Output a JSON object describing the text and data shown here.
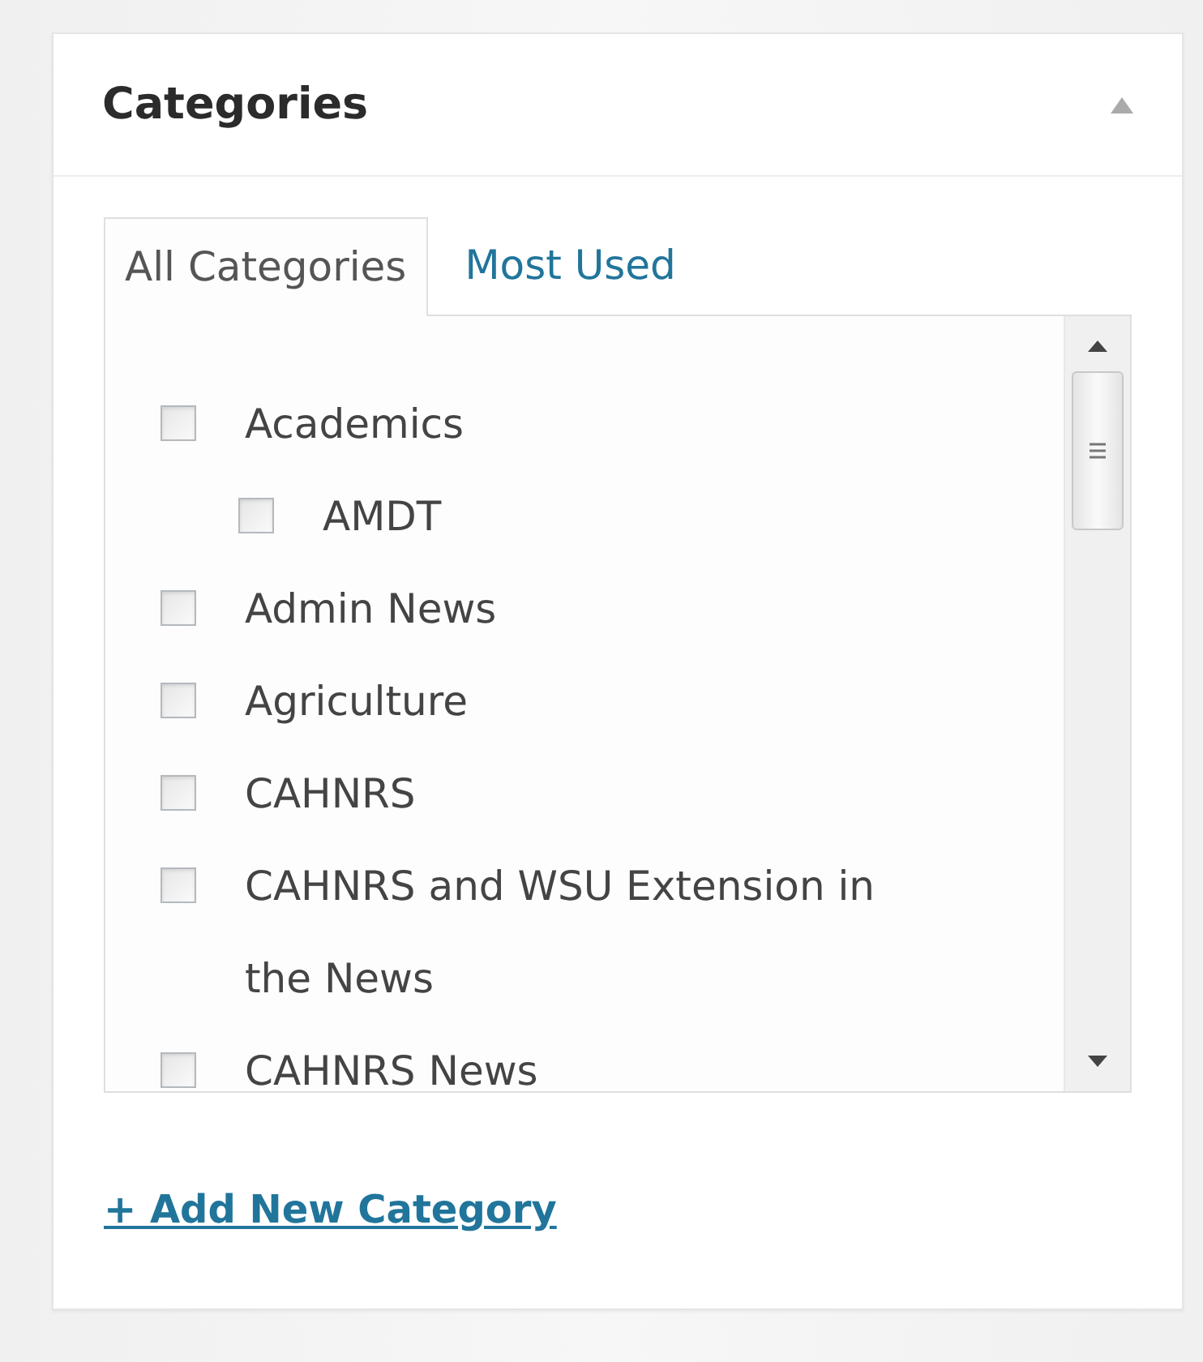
{
  "panel": {
    "title": "Categories"
  },
  "tabs": [
    {
      "label": "All Categories",
      "selected": true
    },
    {
      "label": "Most Used",
      "selected": false
    }
  ],
  "categories": [
    {
      "label": "Academics",
      "checked": false,
      "children": [
        {
          "label": "AMDT",
          "checked": false
        }
      ]
    },
    {
      "label": "Admin News",
      "checked": false
    },
    {
      "label": "Agriculture",
      "checked": false
    },
    {
      "label": "CAHNRS",
      "checked": false
    },
    {
      "label": "CAHNRS and WSU Extension in the News",
      "checked": false
    },
    {
      "label": "CAHNRS News",
      "checked": false
    }
  ],
  "add_link": "+ Add New Category"
}
